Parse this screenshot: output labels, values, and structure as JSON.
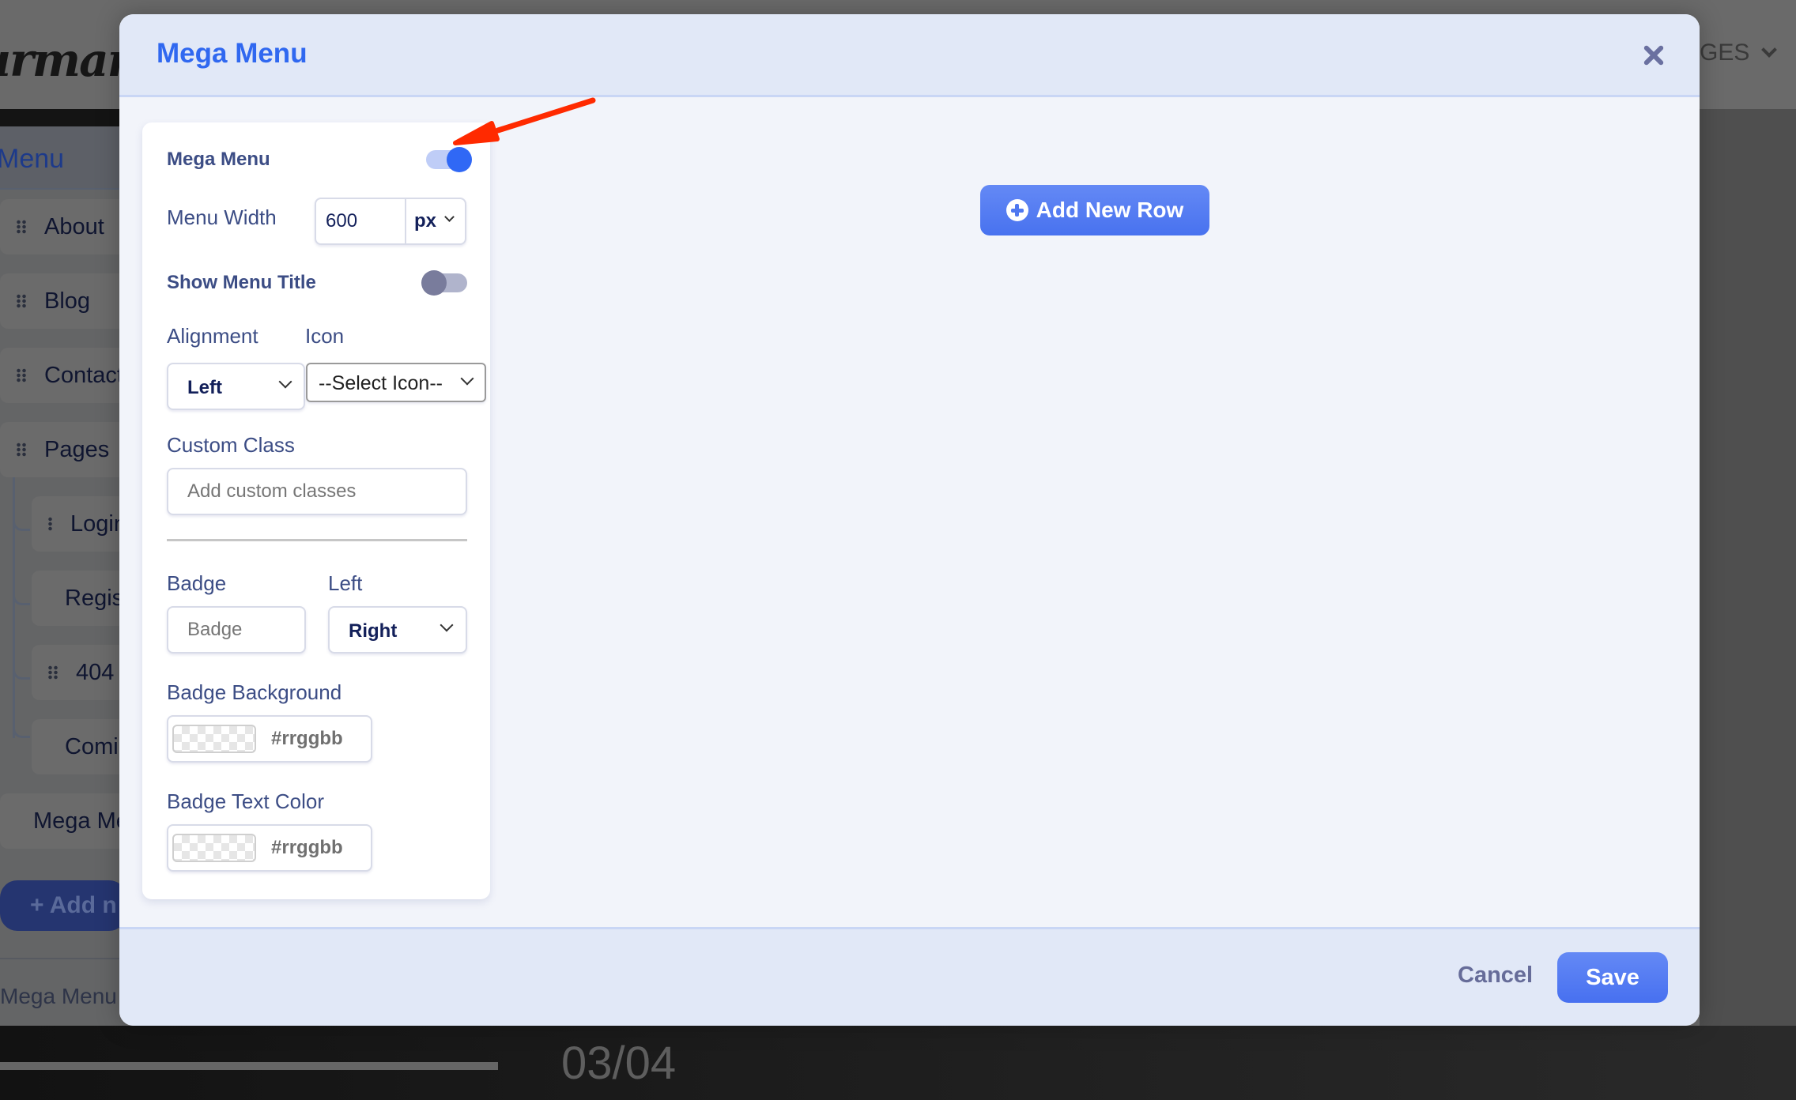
{
  "background": {
    "logo_text": "urman",
    "nav_item": "GES",
    "menu_heading": "Menu",
    "menu_items": [
      {
        "label": "About",
        "level": 0
      },
      {
        "label": "Blog",
        "level": 0
      },
      {
        "label": "Contact",
        "level": 0
      },
      {
        "label": "Pages",
        "level": 0
      },
      {
        "label": "Login",
        "level": 1
      },
      {
        "label": "Register",
        "level": 1
      },
      {
        "label": "404",
        "level": 1
      },
      {
        "label": "Coming Soon",
        "level": 1
      },
      {
        "label": "Mega Menu",
        "level": 0
      }
    ],
    "add_button_label": "+ Add n",
    "footer_text": "Mega Menu",
    "slide_counter": "03/04"
  },
  "modal": {
    "title": "Mega Menu",
    "close_label": "×",
    "settings": {
      "mega_menu_label": "Mega Menu",
      "mega_menu_enabled": true,
      "menu_width_label": "Menu Width",
      "menu_width_value": "600",
      "menu_width_unit": "px",
      "show_menu_title_label": "Show Menu Title",
      "show_menu_title_enabled": false,
      "alignment_label": "Alignment",
      "alignment_value": "Left",
      "icon_label": "Icon",
      "icon_value": "--Select Icon--",
      "custom_class_label": "Custom Class",
      "custom_class_placeholder": "Add custom classes",
      "custom_class_value": "",
      "badge_label": "Badge",
      "badge_placeholder": "Badge",
      "badge_position_label": "Left",
      "badge_position_value": "Right",
      "badge_background_label": "Badge Background",
      "badge_background_placeholder": "#rrggbb",
      "badge_text_color_label": "Badge Text Color",
      "badge_text_color_placeholder": "#rrggbb"
    },
    "add_row_label": "Add New Row",
    "cancel_label": "Cancel",
    "save_label": "Save"
  },
  "colors": {
    "accent": "#3068f0",
    "annotation_arrow": "#ff2a00"
  }
}
